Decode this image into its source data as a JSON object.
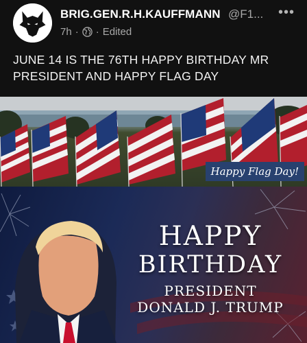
{
  "post": {
    "author": "BRIG.GEN.R.H.KAUFFMANN",
    "handle": "@F1...",
    "time": "7h",
    "separator": "·",
    "edited": "Edited",
    "text": "JUNE 14 IS THE 76TH HAPPY BIRTHDAY MR PRESIDENT AND HAPPY FLAG DAY",
    "avatar_icon": "wolf-icon",
    "audience_icon": "globe-icon",
    "more_icon": "more-options-icon"
  },
  "media": {
    "flag_caption": "Happy Flag Day!",
    "greeting": {
      "line1": "HAPPY",
      "line2": "BIRTHDAY",
      "line3": "PRESIDENT",
      "line4": "DONALD J. TRUMP"
    }
  },
  "colors": {
    "background": "#111111",
    "caption_banner": "#28416f",
    "secondary_text": "#a9a9a9"
  }
}
